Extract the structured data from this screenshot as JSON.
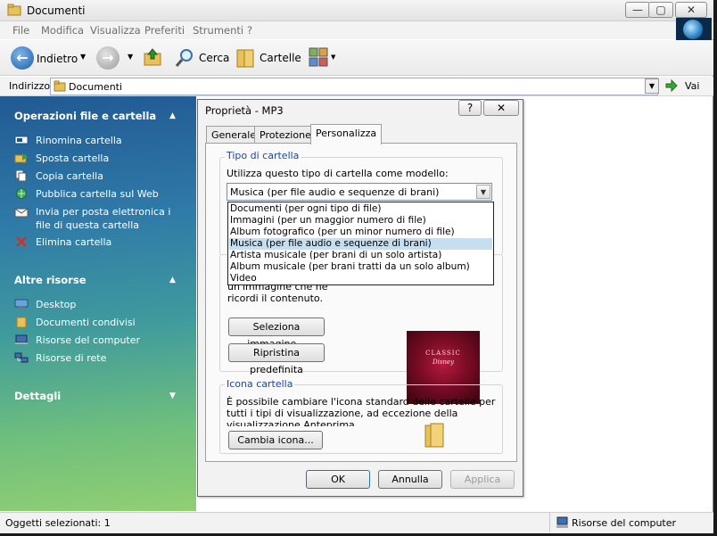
{
  "window": {
    "title": "Documenti",
    "menu": [
      "File",
      "Modifica",
      "Visualizza",
      "Preferiti",
      "Strumenti",
      "?"
    ]
  },
  "toolbar": {
    "back_label": "Indietro",
    "search_label": "Cerca",
    "folders_label": "Cartelle"
  },
  "address": {
    "label": "Indirizzo",
    "value": "Documenti",
    "go_label": "Vai"
  },
  "sidebar": {
    "sections": [
      {
        "title": "Operazioni file e cartella",
        "items": [
          {
            "label": "Rinomina cartella",
            "icon": "rename-icon"
          },
          {
            "label": "Sposta cartella",
            "icon": "move-folder-icon"
          },
          {
            "label": "Copia cartella",
            "icon": "copy-icon"
          },
          {
            "label": "Pubblica cartella sul Web",
            "icon": "web-publish-icon"
          },
          {
            "label": "Invia per posta elettronica i file di questa cartella",
            "icon": "email-icon"
          },
          {
            "label": "Elimina cartella",
            "icon": "delete-icon"
          }
        ]
      },
      {
        "title": "Altre risorse",
        "items": [
          {
            "label": "Desktop",
            "icon": "desktop-icon"
          },
          {
            "label": "Documenti condivisi",
            "icon": "shared-folder-icon"
          },
          {
            "label": "Risorse del computer",
            "icon": "computer-icon"
          },
          {
            "label": "Risorse di rete",
            "icon": "network-icon"
          }
        ]
      },
      {
        "title": "Dettagli",
        "items": []
      }
    ]
  },
  "dialog": {
    "title": "Proprietà - MP3",
    "help_label": "?",
    "close_label": "✕",
    "tabs": [
      "Generale",
      "Protezione",
      "Personalizza"
    ],
    "active_tab": "Personalizza",
    "folder_type": {
      "legend": "Tipo di cartella",
      "prompt": "Utilizza questo tipo di cartella come modello:",
      "selected": "Musica (per file audio e sequenze di brani)",
      "options": [
        "Documenti (per ogni tipo di file)",
        "Immagini (per un maggior numero di file)",
        "Album fotografico (per un minor numero di file)",
        "Musica (per file audio e sequenze di brani)",
        "Artista musicale (per brani di un solo artista)",
        "Album musicale (per brani tratti da un solo album)",
        "Video"
      ]
    },
    "folder_image": {
      "text": "un'immagine che ne ricordi il contenuto.",
      "select_button": "Seleziona immagine...",
      "restore_button": "Ripristina predefinita",
      "cover_title": "CLASSIC",
      "cover_brand": "Disney"
    },
    "folder_icon": {
      "legend": "Icona cartella",
      "text": "È possibile cambiare l'icona standard delle cartelle per tutti i tipi di visualizzazione, ad eccezione della visualizzazione Anteprima",
      "change_button": "Cambia icona..."
    },
    "ok_label": "OK",
    "cancel_label": "Annulla",
    "apply_label": "Applica"
  },
  "statusbar": {
    "left": "Oggetti selezionati: 1",
    "right": "Risorse del computer"
  },
  "colors": {
    "accent_blue": "#1c46a8",
    "selection": "#c5dff1"
  }
}
